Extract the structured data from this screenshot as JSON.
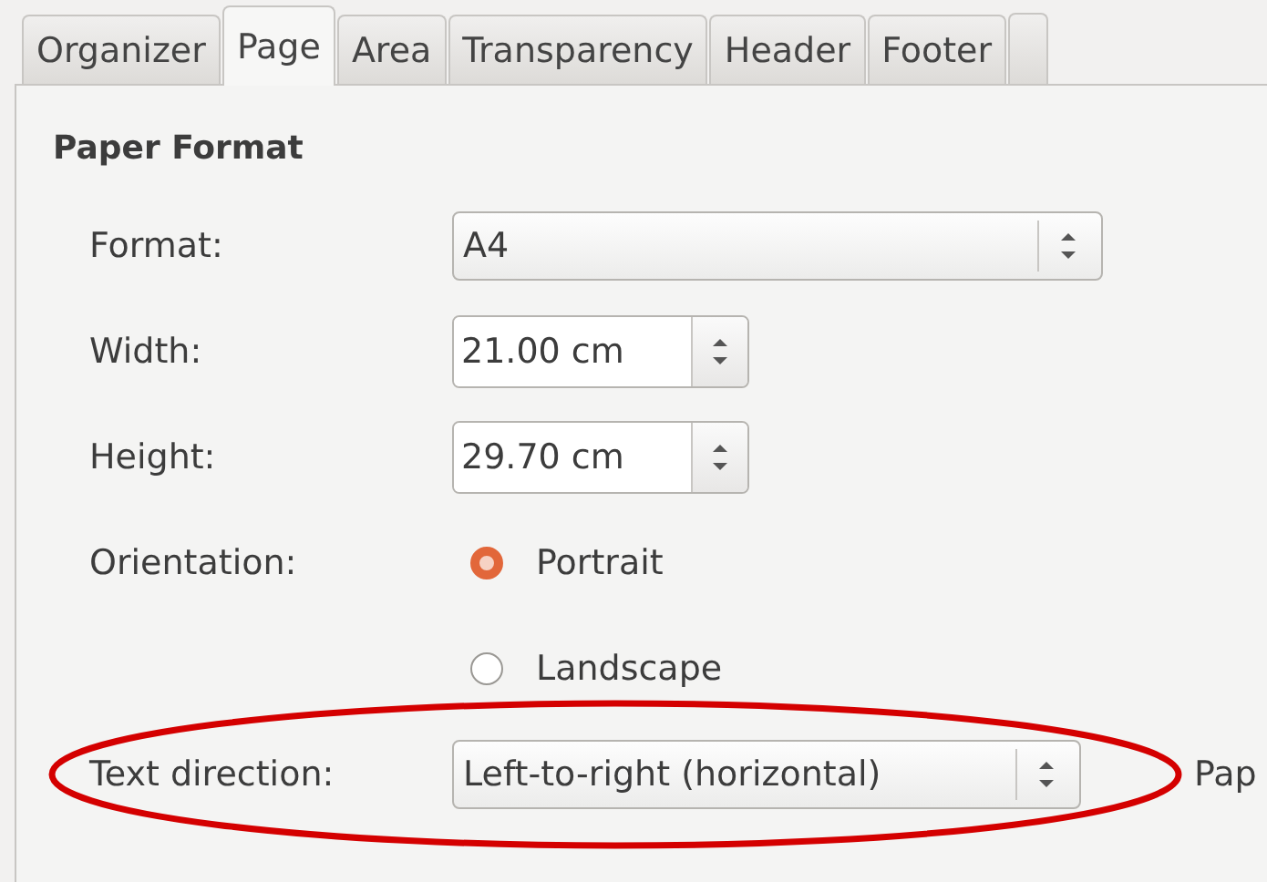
{
  "tabs": [
    {
      "label": "Organizer",
      "selected": false
    },
    {
      "label": "Page",
      "selected": true
    },
    {
      "label": "Area",
      "selected": false
    },
    {
      "label": "Transparency",
      "selected": false
    },
    {
      "label": "Header",
      "selected": false
    },
    {
      "label": "Footer",
      "selected": false
    }
  ],
  "section_title": "Paper Format",
  "format": {
    "label": "Format:",
    "value": "A4"
  },
  "width": {
    "label": "Width:",
    "value": "21.00 cm"
  },
  "height": {
    "label": "Height:",
    "value": "29.70 cm"
  },
  "orientation": {
    "label": "Orientation:",
    "options": [
      {
        "label": "Portrait",
        "selected": true
      },
      {
        "label": "Landscape",
        "selected": false
      }
    ]
  },
  "text_direction": {
    "label": "Text direction:",
    "value": "Left-to-right (horizontal)",
    "highlighted": true
  },
  "side_label": "Pap"
}
